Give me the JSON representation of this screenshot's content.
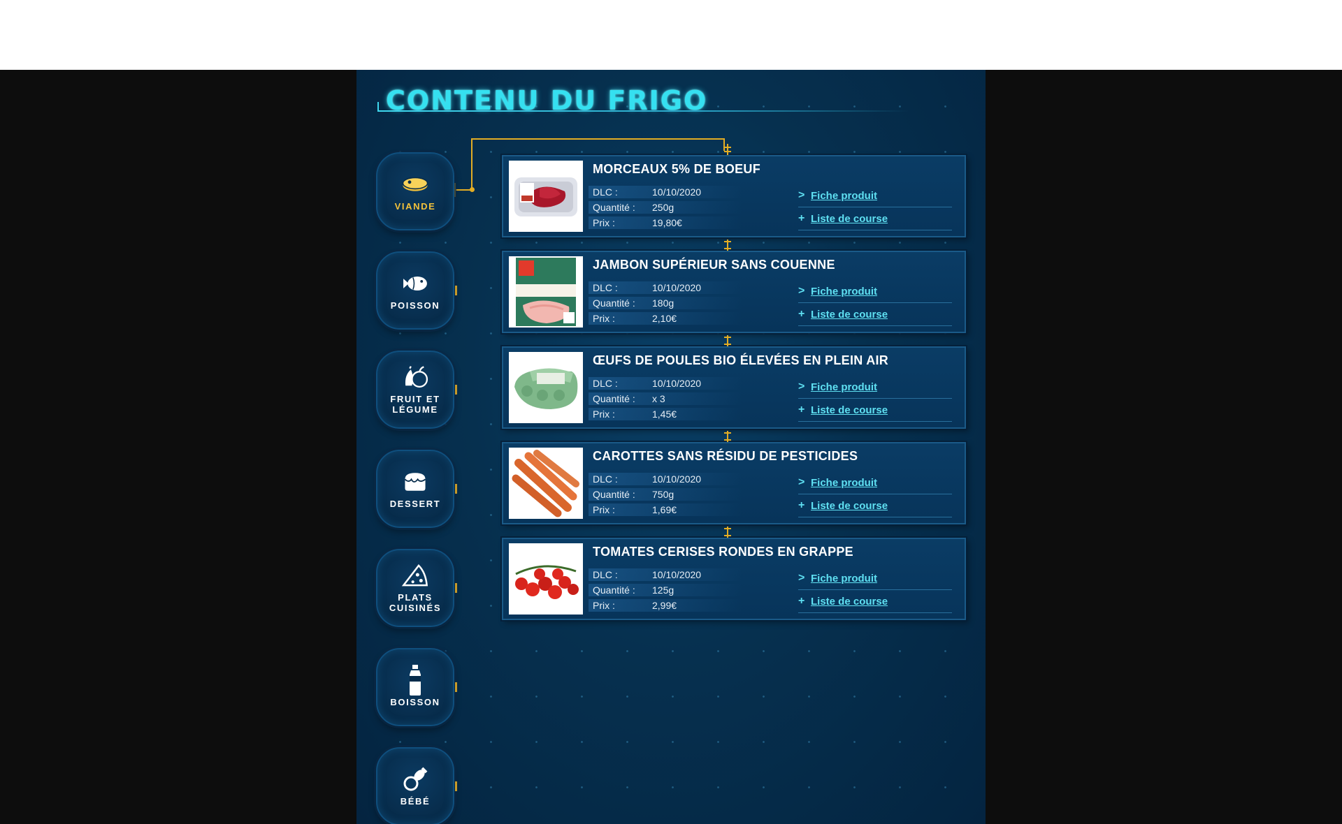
{
  "page": {
    "title": "Contenu du frigo"
  },
  "colors": {
    "accent": "#35e0f0",
    "link": "#5fe0f2",
    "connector": "#e3ad24",
    "active_label": "#f2c13b",
    "panel": "#06304f"
  },
  "categories": [
    {
      "label": "Viande",
      "icon": "steak-icon",
      "active": true
    },
    {
      "label": "Poisson",
      "icon": "fish-icon",
      "active": false
    },
    {
      "label": "Fruit et légume",
      "icon": "fruit-vegetable-icon",
      "active": false
    },
    {
      "label": "Dessert",
      "icon": "dessert-icon",
      "active": false
    },
    {
      "label": "Plats cuisinés",
      "icon": "pizza-icon",
      "active": false
    },
    {
      "label": "Boisson",
      "icon": "bottle-icon",
      "active": false
    },
    {
      "label": "Bébé",
      "icon": "pacifier-icon",
      "active": false
    }
  ],
  "labels": {
    "dlc": "DLC :",
    "quantity": "Quantité :",
    "price": "Prix :",
    "fiche": "Fiche produit",
    "liste": "Liste de course",
    "fiche_symbol": ">",
    "liste_symbol": "+"
  },
  "products": [
    {
      "name": "MORCEAUX 5% DE BOEUF",
      "dlc": "10/10/2020",
      "quantity": "250g",
      "price": "19,80€",
      "image": "beef-pack"
    },
    {
      "name": "JAMBON SUPÉRIEUR SANS COUENNE",
      "dlc": "10/10/2020",
      "quantity": "180g",
      "price": "2,10€",
      "image": "ham-pack"
    },
    {
      "name": "ŒUFS DE POULES BIO ÉLEVÉES EN PLEIN AIR",
      "dlc": "10/10/2020",
      "quantity": "x 3",
      "price": "1,45€",
      "image": "egg-carton"
    },
    {
      "name": "CAROTTES SANS RÉSIDU DE PESTICIDES",
      "dlc": "10/10/2020",
      "quantity": "750g",
      "price": "1,69€",
      "image": "carrots"
    },
    {
      "name": "TOMATES CERISES RONDES EN GRAPPE",
      "dlc": "10/10/2020",
      "quantity": "125g",
      "price": "2,99€",
      "image": "cherry-tomatoes"
    }
  ]
}
